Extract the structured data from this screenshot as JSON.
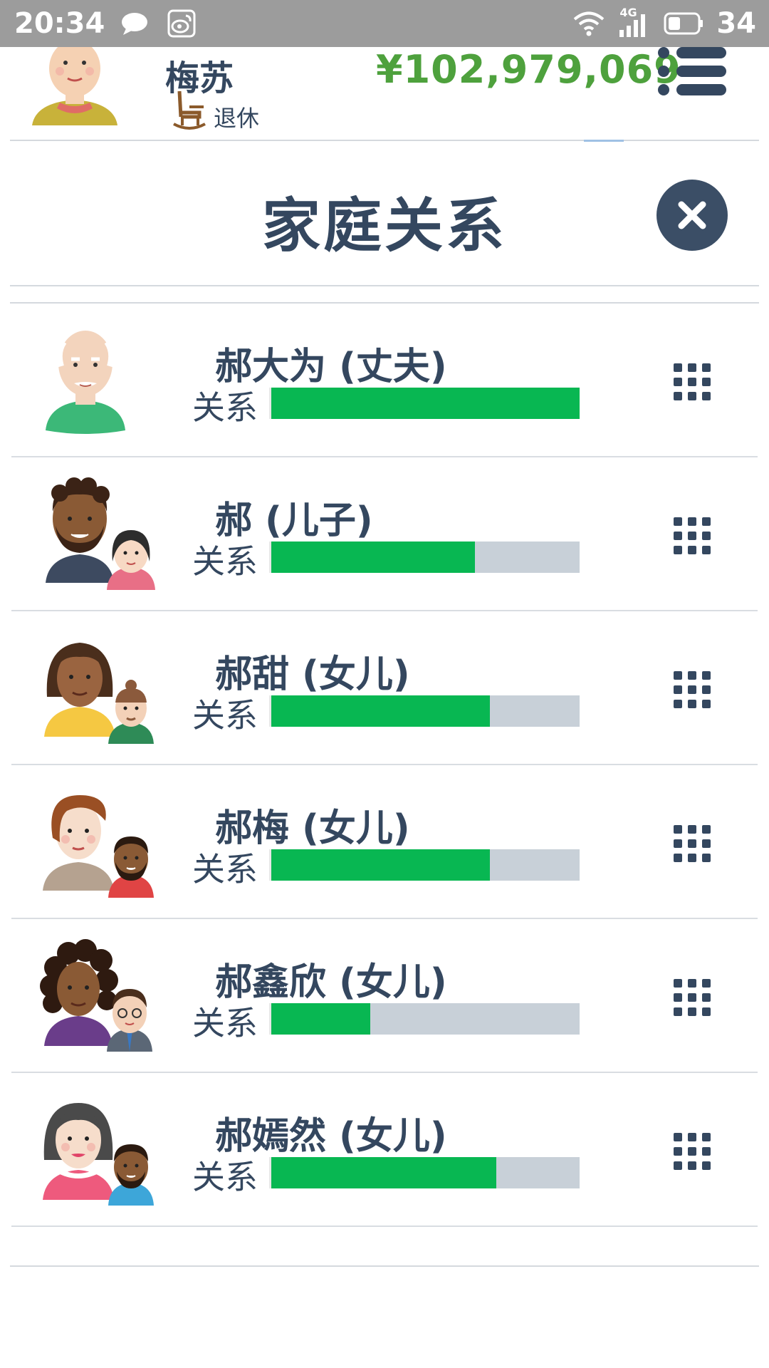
{
  "status_bar": {
    "time": "20:34",
    "network": "4G",
    "battery": "34",
    "icons": [
      "chat-bubble-icon",
      "weibo-icon",
      "wifi-icon",
      "signal-icon",
      "battery-icon"
    ]
  },
  "header": {
    "name": "梅苏",
    "job": "退休",
    "money": "¥102,979,069"
  },
  "modal": {
    "title": "家庭关系"
  },
  "members": [
    {
      "name": "郝大为 (丈夫)",
      "relation_label": "关系",
      "relation": 1.0
    },
    {
      "name": "郝 (儿子)",
      "relation_label": "关系",
      "relation": 0.66
    },
    {
      "name": "郝甜 (女儿)",
      "relation_label": "关系",
      "relation": 0.71
    },
    {
      "name": "郝梅 (女儿)",
      "relation_label": "关系",
      "relation": 0.71
    },
    {
      "name": "郝鑫欣 (女儿)",
      "relation_label": "关系",
      "relation": 0.32
    },
    {
      "name": "郝嫣然 (女儿)",
      "relation_label": "关系",
      "relation": 0.73
    }
  ],
  "colors": {
    "bar_fill": "#08b752",
    "bar_track": "#c8d0d8",
    "money": "#4ea13d",
    "text": "#34475f"
  }
}
